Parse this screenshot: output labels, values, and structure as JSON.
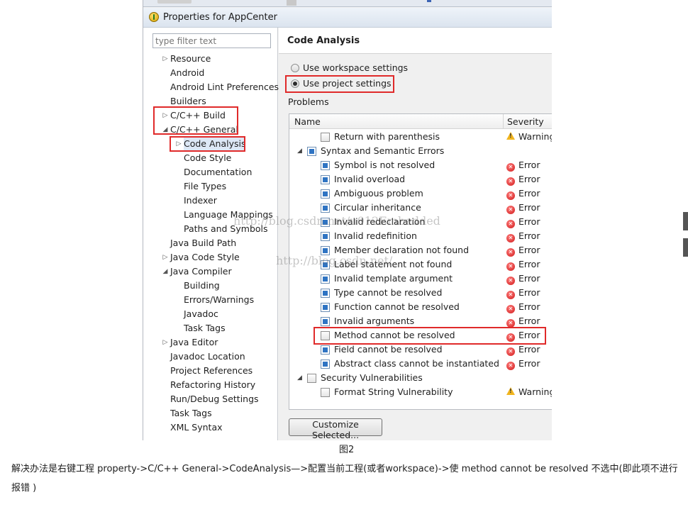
{
  "window": {
    "title": "Properties for AppCenter",
    "filter_placeholder": "type filter text"
  },
  "tree": [
    {
      "label": "Resource"
    },
    {
      "label": "Android"
    },
    {
      "label": "Android Lint Preferences"
    },
    {
      "label": "Builders"
    },
    {
      "label": "C/C++ Build"
    },
    {
      "label": "C/C++ General"
    },
    {
      "label": "Code Analysis"
    },
    {
      "label": "Code Style"
    },
    {
      "label": "Documentation"
    },
    {
      "label": "File Types"
    },
    {
      "label": "Indexer"
    },
    {
      "label": "Language Mappings"
    },
    {
      "label": "Paths and Symbols"
    },
    {
      "label": "Java Build Path"
    },
    {
      "label": "Java Code Style"
    },
    {
      "label": "Java Compiler"
    },
    {
      "label": "Building"
    },
    {
      "label": "Errors/Warnings"
    },
    {
      "label": "Javadoc"
    },
    {
      "label": "Task Tags"
    },
    {
      "label": "Java Editor"
    },
    {
      "label": "Javadoc Location"
    },
    {
      "label": "Project References"
    },
    {
      "label": "Refactoring History"
    },
    {
      "label": "Run/Debug Settings"
    },
    {
      "label": "Task Tags"
    },
    {
      "label": "XML Syntax"
    }
  ],
  "panel": {
    "title": "Code Analysis",
    "radio_workspace": "Use workspace settings",
    "radio_project": "Use project settings",
    "radio_selected": "project",
    "problems_label": "Problems",
    "columns": {
      "name": "Name",
      "severity": "Severity"
    },
    "customize_button": "Customize Selected..."
  },
  "problems": [
    {
      "name": "Return with parenthesis",
      "severity": "Warning",
      "checked": false
    },
    {
      "name": "Syntax and Semantic Errors",
      "severity": "",
      "checked": true,
      "group": true
    },
    {
      "name": "Symbol is not resolved",
      "severity": "Error",
      "checked": true
    },
    {
      "name": "Invalid overload",
      "severity": "Error",
      "checked": true
    },
    {
      "name": "Ambiguous problem",
      "severity": "Error",
      "checked": true
    },
    {
      "name": "Circular inheritance",
      "severity": "Error",
      "checked": true
    },
    {
      "name": "Invalid redeclaration",
      "severity": "Error",
      "checked": true
    },
    {
      "name": "Invalid redefinition",
      "severity": "Error",
      "checked": true
    },
    {
      "name": "Member declaration not found",
      "severity": "Error",
      "checked": true
    },
    {
      "name": "Label statement not found",
      "severity": "Error",
      "checked": true
    },
    {
      "name": "Invalid template argument",
      "severity": "Error",
      "checked": true
    },
    {
      "name": "Type cannot be resolved",
      "severity": "Error",
      "checked": true
    },
    {
      "name": "Function cannot be resolved",
      "severity": "Error",
      "checked": true
    },
    {
      "name": "Invalid arguments",
      "severity": "Error",
      "checked": true
    },
    {
      "name": "Method cannot be resolved",
      "severity": "Error",
      "checked": false
    },
    {
      "name": "Field cannot be resolved",
      "severity": "Error",
      "checked": true
    },
    {
      "name": "Abstract class cannot be instantiated",
      "severity": "Error",
      "checked": true
    },
    {
      "name": "Security Vulnerabilities",
      "severity": "",
      "checked": false,
      "group": true
    },
    {
      "name": "Format String Vulnerability",
      "severity": "Warning",
      "checked": false
    }
  ],
  "watermarks": {
    "line1": "http://blog.csdn.net/u012Embedded",
    "line2": "http://blog.csdn.net/"
  },
  "caption": "图2",
  "note": "解决办法是右键工程 property->C/C++ General->CodeAnalysis—>配置当前工程(或者workspace)->使 method cannot be resolved  不选中(即此项不进行报错 )",
  "colors": {
    "highlight_box": "#e02a2a",
    "checkbox_fill": "#2f74c3",
    "error_icon": "#d01818",
    "warning_icon": "#f1b51e"
  }
}
